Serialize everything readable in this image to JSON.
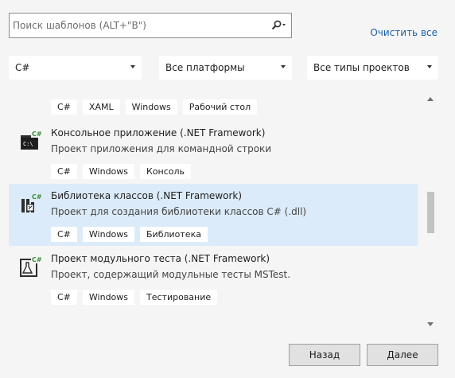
{
  "search": {
    "placeholder": "Поиск шаблонов (ALT+\"В\")"
  },
  "clear_all_label": "Очистить все",
  "filters": {
    "language": "C#",
    "platform": "Все платформы",
    "project_type": "Все типы проектов"
  },
  "partial_item": {
    "tags": [
      "C#",
      "XAML",
      "Windows",
      "Рабочий стол"
    ]
  },
  "templates": [
    {
      "title": "Консольное приложение (.NET Framework)",
      "description": "Проект приложения для командной строки",
      "tags": [
        "C#",
        "Windows",
        "Консоль"
      ],
      "icon": "console-app-icon",
      "icon_badge": "C#",
      "selected": false
    },
    {
      "title": "Библиотека классов (.NET Framework)",
      "description": "Проект для создания библиотеки классов C# (.dll)",
      "tags": [
        "C#",
        "Windows",
        "Библиотека"
      ],
      "icon": "class-library-icon",
      "icon_badge": "C#",
      "selected": true
    },
    {
      "title": "Проект модульного теста (.NET Framework)",
      "description": "Проект, содержащий модульные тесты MSTest.",
      "tags": [
        "C#",
        "Windows",
        "Тестирование"
      ],
      "icon": "unit-test-icon",
      "icon_badge": "C#",
      "selected": false
    }
  ],
  "buttons": {
    "back": "Назад",
    "next": "Далее"
  },
  "colors": {
    "selection": "#dcebf9",
    "accent_link": "#1a5ea8",
    "badge_green": "#388a34"
  }
}
